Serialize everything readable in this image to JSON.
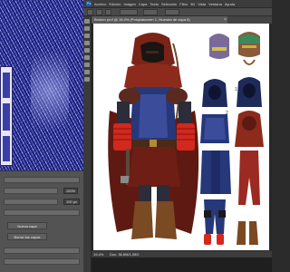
{
  "app": {
    "menu": [
      "Archivo",
      "Edición",
      "Imagen",
      "Capa",
      "Texto",
      "Selección",
      "Filtro",
      "3D",
      "Vista",
      "Ventana",
      "Ayuda"
    ],
    "logo_text": "Ps"
  },
  "document": {
    "tab_title": "Broken prof @ 19,4% (Potsjnakovien 1, Muestra de capa 8)",
    "zoom": "19.4%",
    "doc_size": "Doc: 36,6M/1,08G",
    "sheet_numbers": [
      "1",
      "2"
    ]
  },
  "dock": {
    "field_values": [
      "100%",
      "100 px"
    ],
    "buttons": [
      "Nueva capa",
      "Borrar las capas"
    ]
  },
  "colors": {
    "ui_dark": "#3c3c3c",
    "ui_panel": "#535353",
    "sketch_blue": "#24288f",
    "cloak_red": "#7a2418",
    "armor_blue": "#26377a"
  }
}
